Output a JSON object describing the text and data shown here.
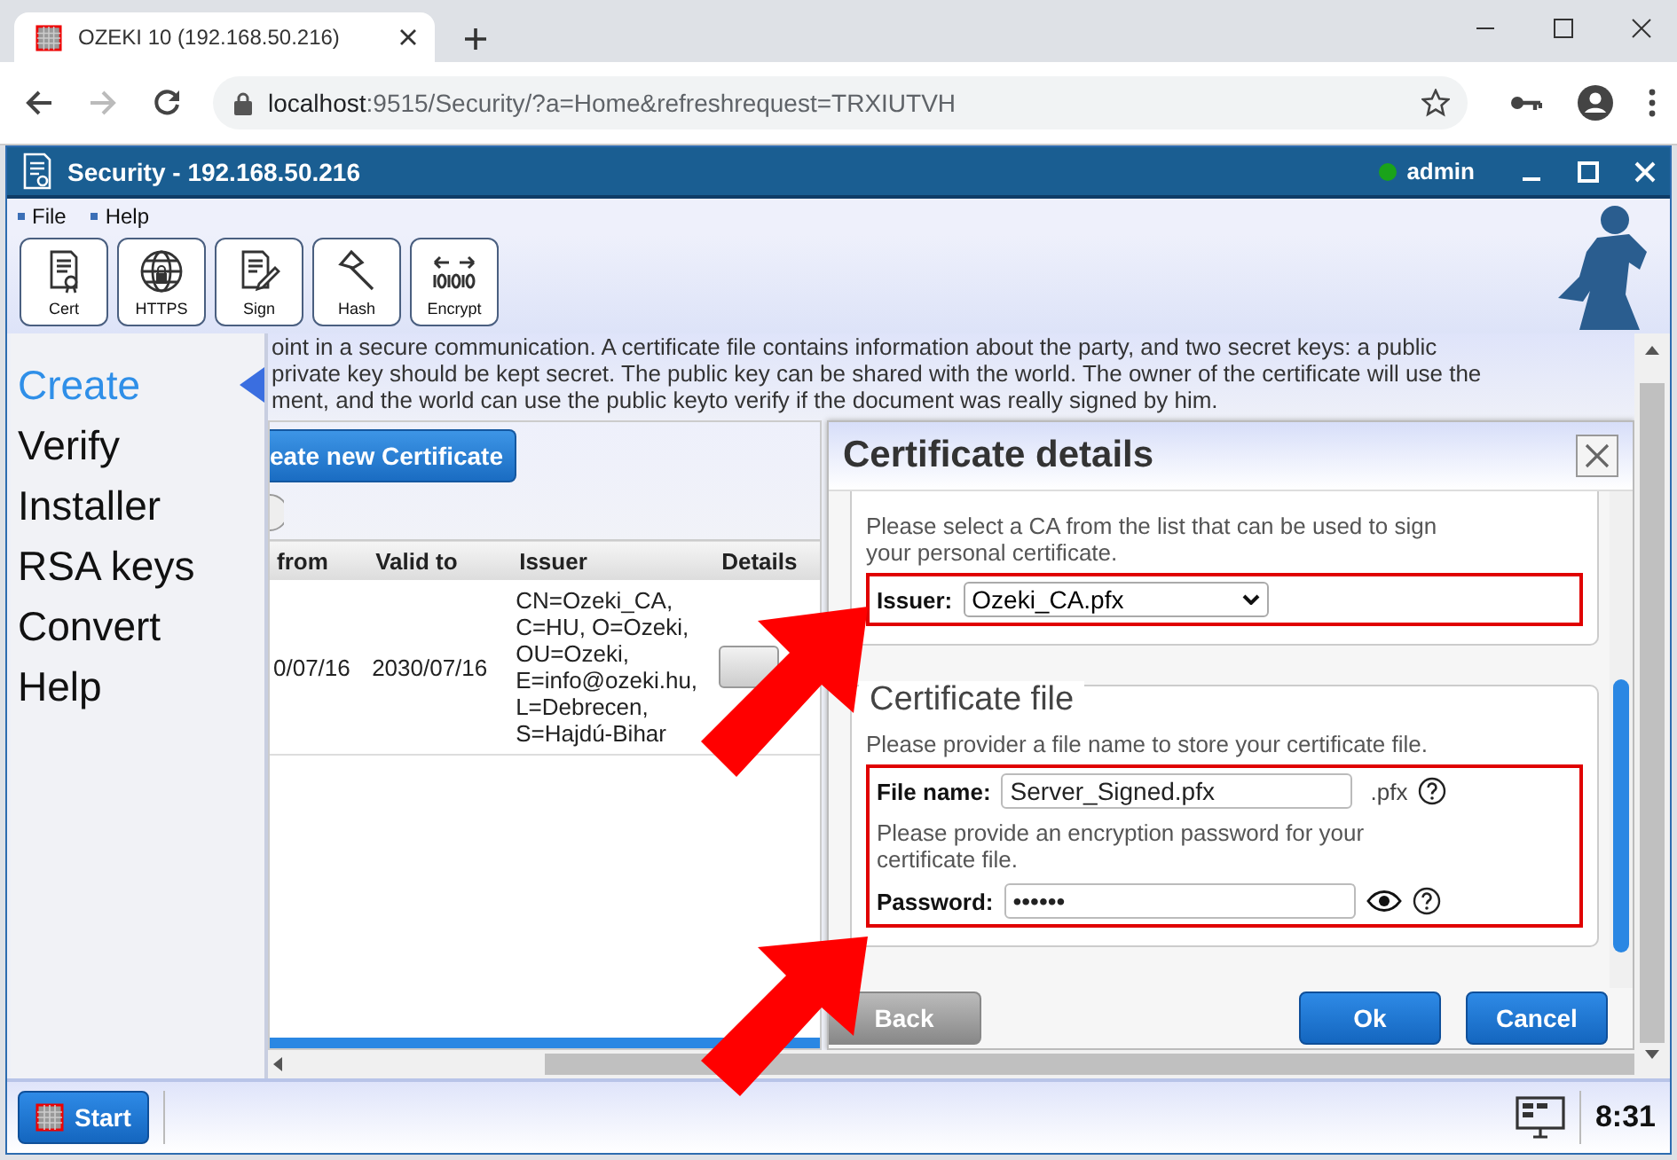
{
  "browser": {
    "tab_title": "OZEKI 10 (192.168.50.216)",
    "url_host": "localhost",
    "url_rest": ":9515/Security/?a=Home&refreshrequest=TRXIUTVH"
  },
  "app": {
    "title": "Security - 192.168.50.216",
    "user": "admin"
  },
  "menu": [
    "File",
    "Help"
  ],
  "toolbar": [
    {
      "label": "Cert",
      "kind": "cert"
    },
    {
      "label": "HTTPS",
      "kind": "https"
    },
    {
      "label": "Sign",
      "kind": "sign"
    },
    {
      "label": "Hash",
      "kind": "hash"
    },
    {
      "label": "Encrypt",
      "kind": "encrypt"
    }
  ],
  "description": [
    "oint in a secure communication. A certificate file contains information about the party, and two secret keys: a public",
    "private key should be kept secret. The public key can be shared with the world. The owner of the certificate will use the",
    "ment, and the world can use the public keyto verify if the document was really signed by him."
  ],
  "sidebar": {
    "items": [
      {
        "label": "Create",
        "selected": true
      },
      {
        "label": "Verify",
        "selected": false
      },
      {
        "label": "Installer",
        "selected": false
      },
      {
        "label": "RSA keys",
        "selected": false
      },
      {
        "label": "Convert",
        "selected": false
      },
      {
        "label": "Help",
        "selected": false
      }
    ]
  },
  "certificates": {
    "create_button": "eate new Certificate",
    "columns": [
      "from",
      "Valid to",
      "Issuer",
      "Details"
    ],
    "rows": [
      {
        "from": "0/07/16",
        "valid_to": "2030/07/16",
        "issuer": "CN=Ozeki_CA, C=HU, O=Ozeki, OU=Ozeki, E=info@ozeki.hu, L=Debrecen, S=Hajdú-Bihar"
      }
    ]
  },
  "dialog": {
    "title": "Certificate details",
    "issuer_hint": "Please select a CA from the list that can be used to sign your personal certificate.",
    "issuer_label": "Issuer:",
    "issuer_value": "Ozeki_CA.pfx",
    "file_legend": "Certificate file",
    "file_hint": "Please provider a file name to store your certificate file.",
    "file_label": "File name:",
    "file_value": "Server_Signed.pfx",
    "file_ext": ".pfx",
    "password_hint": "Please provide an encryption password for your certificate file.",
    "password_label": "Password:",
    "password_value": "••••••",
    "buttons": [
      "Back",
      "Ok",
      "Cancel"
    ]
  },
  "taskbar": {
    "start": "Start",
    "time": "8:31"
  }
}
